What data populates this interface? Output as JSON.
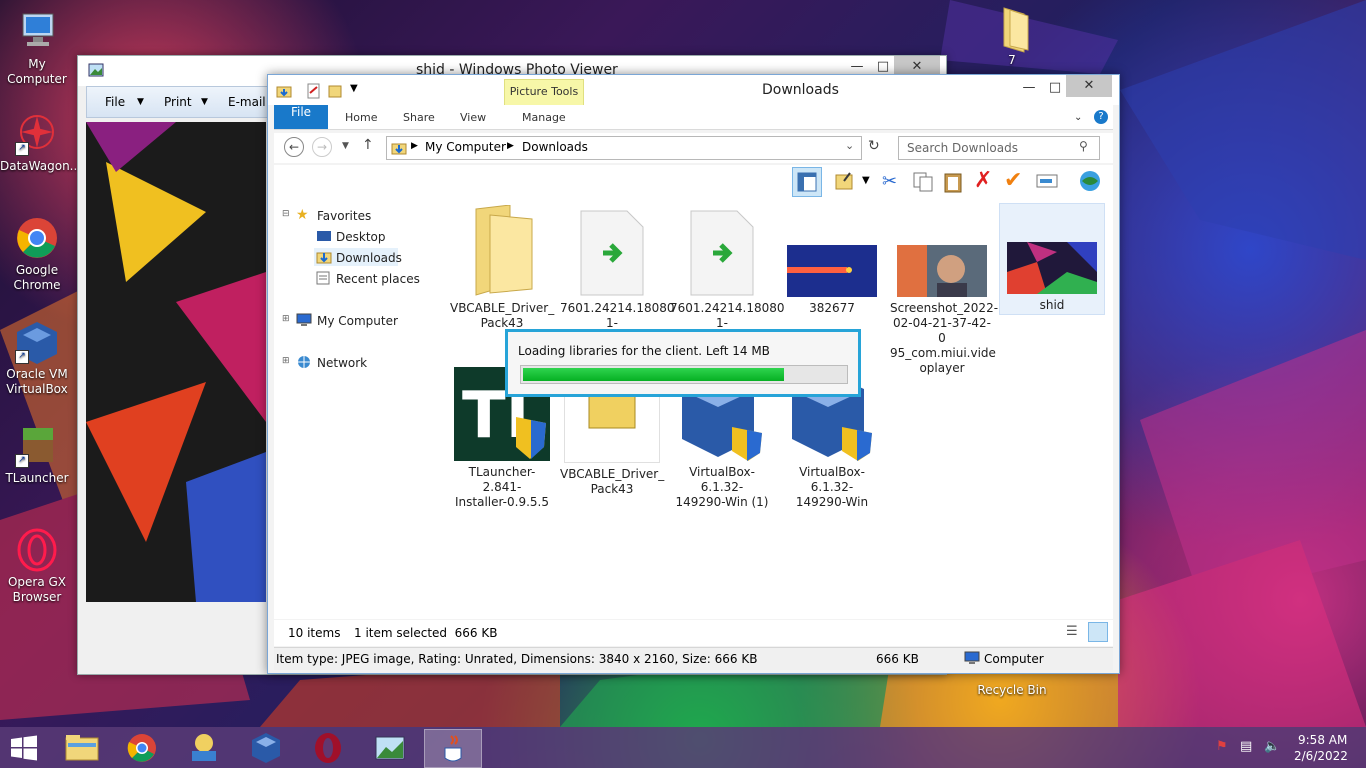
{
  "desktop": {
    "icons": [
      {
        "label": "My Computer"
      },
      {
        "label": "DataWagon..."
      },
      {
        "label": "Google Chrome"
      },
      {
        "label": "Oracle VM VirtualBox"
      },
      {
        "label": "TLauncher"
      },
      {
        "label": "Opera GX Browser"
      }
    ],
    "folder_label": "7",
    "recycle_label": "Recycle Bin"
  },
  "photo_viewer": {
    "title": "shid - Windows Photo Viewer",
    "menu": {
      "file": "File",
      "print": "Print",
      "email": "E-mail"
    }
  },
  "explorer": {
    "title": "Downloads",
    "picture_tools": "Picture Tools",
    "tabs": {
      "file": "File",
      "home": "Home",
      "share": "Share",
      "view": "View",
      "manage": "Manage"
    },
    "address": {
      "root": "My Computer",
      "current": "Downloads"
    },
    "search_placeholder": "Search Downloads",
    "nav": {
      "favorites": "Favorites",
      "desktop": "Desktop",
      "downloads": "Downloads",
      "recent": "Recent places",
      "computer": "My Computer",
      "network": "Network"
    },
    "files": [
      {
        "name": "VBCABLE_Driver_\nPack43"
      },
      {
        "name": "7601.24214.18080\n1-1700.win7sp1_l"
      },
      {
        "name": "7601.24214.18080\n1-1700.win7sp1_l"
      },
      {
        "name": "382677"
      },
      {
        "name": "Screenshot_2022-\n02-04-21-37-42-0\n95_com.miui.vide\noplayer"
      },
      {
        "name": "shid"
      },
      {
        "name": "TLauncher-2.841-\nInstaller-0.9.5.5"
      },
      {
        "name": "VBCABLE_Driver_\nPack43"
      },
      {
        "name": "VirtualBox-6.1.32-\n149290-Win (1)"
      },
      {
        "name": "VirtualBox-6.1.32-\n149290-Win"
      }
    ],
    "status": {
      "count": "10 items",
      "selected": "1 item selected  666 KB"
    },
    "details": {
      "text": "Item type: JPEG image, Rating: Unrated, Dimensions: 3840 x 2160, Size: 666 KB",
      "size": "666 KB",
      "location": "Computer"
    }
  },
  "loader": {
    "message": "Loading libraries for the client. Left 14 MB",
    "progress": 0.81
  },
  "taskbar": {
    "time": "9:58 AM",
    "date": "2/6/2022"
  },
  "colors": {
    "accent": "#1979ca",
    "progress": "#06b023",
    "highlight": "#27a4d8"
  }
}
